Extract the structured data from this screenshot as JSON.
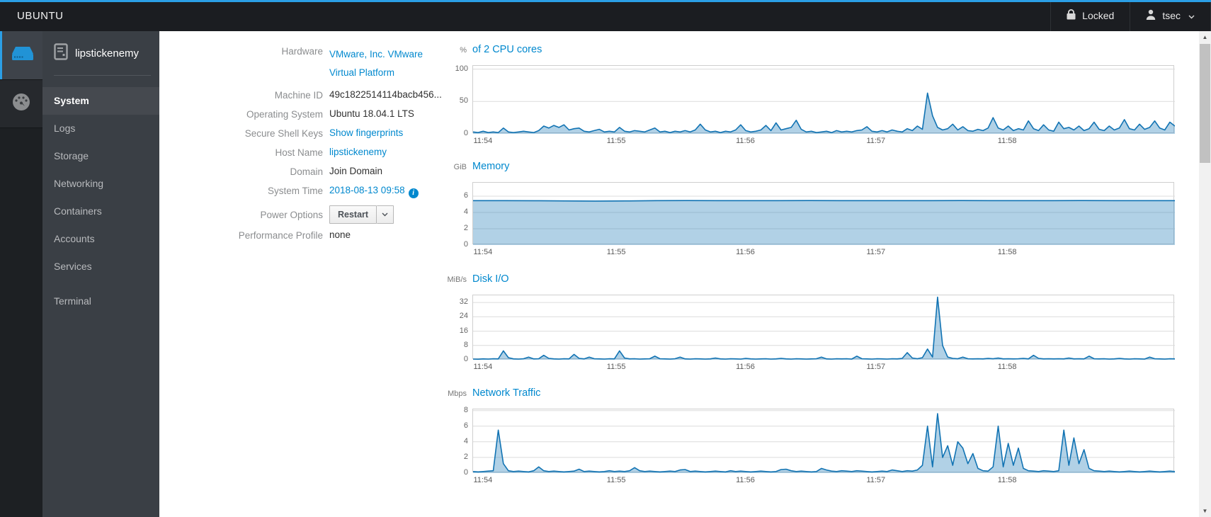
{
  "topbar": {
    "brand": "UBUNTU",
    "locked_label": "Locked",
    "user": "tsec"
  },
  "sidebar": {
    "host": "lipstickenemy",
    "items": [
      {
        "label": "System"
      },
      {
        "label": "Logs"
      },
      {
        "label": "Storage"
      },
      {
        "label": "Networking"
      },
      {
        "label": "Containers"
      },
      {
        "label": "Accounts"
      },
      {
        "label": "Services"
      }
    ],
    "secondary_items": [
      {
        "label": "Terminal"
      }
    ]
  },
  "info": {
    "rows": [
      {
        "label": "Hardware",
        "value_lines": [
          "VMware, Inc. VMware",
          "Virtual Platform"
        ]
      },
      {
        "label": "Machine ID",
        "value": "49c1822514114bacb456..."
      },
      {
        "label": "Operating System",
        "value": "Ubuntu 18.04.1 LTS"
      },
      {
        "label": "Secure Shell Keys",
        "value": "Show fingerprints"
      },
      {
        "label": "Host Name",
        "value": "lipstickenemy"
      },
      {
        "label": "Domain",
        "value": "Join Domain"
      },
      {
        "label": "System Time",
        "value": "2018-08-13 09:58"
      },
      {
        "label": "Power Options",
        "value": "Restart"
      },
      {
        "label": "Performance Profile",
        "value": "none"
      }
    ],
    "info_icon_glyph": "i"
  },
  "scrollbar": {
    "up_glyph": "▲",
    "down_glyph": "▼"
  },
  "colors": {
    "accent": "#0088ce",
    "topbar_blue": "#2b9fe6",
    "chart_line": "#1173b3",
    "chart_fill": "rgba(49,133,188,0.38)"
  },
  "chart_data": [
    {
      "type": "area",
      "unit": "%",
      "title": "of 2 CPU cores",
      "ylabel": "percent of 2 CPU cores",
      "ylim": [
        0,
        105
      ],
      "yticks": [
        0,
        50,
        100
      ],
      "grid": true,
      "x_ticks": [
        {
          "label": "11:54",
          "frac": 0.015
        },
        {
          "label": "11:55",
          "frac": 0.205
        },
        {
          "label": "11:56",
          "frac": 0.389
        },
        {
          "label": "11:57",
          "frac": 0.575
        },
        {
          "label": "11:58",
          "frac": 0.762
        }
      ],
      "values": [
        3,
        2,
        4,
        2,
        3,
        2,
        9,
        3,
        2,
        3,
        4,
        3,
        2,
        5,
        12,
        9,
        13,
        10,
        14,
        6,
        8,
        9,
        4,
        3,
        5,
        7,
        3,
        4,
        3,
        10,
        4,
        3,
        5,
        4,
        3,
        6,
        9,
        3,
        4,
        2,
        4,
        3,
        5,
        3,
        6,
        15,
        6,
        3,
        4,
        2,
        4,
        3,
        6,
        14,
        5,
        3,
        4,
        6,
        13,
        5,
        17,
        6,
        8,
        10,
        21,
        7,
        3,
        4,
        2,
        3,
        4,
        2,
        5,
        3,
        4,
        3,
        5,
        6,
        11,
        4,
        3,
        5,
        3,
        6,
        4,
        3,
        8,
        5,
        12,
        7,
        63,
        28,
        10,
        6,
        8,
        15,
        6,
        11,
        5,
        4,
        7,
        5,
        9,
        25,
        9,
        6,
        12,
        5,
        8,
        6,
        20,
        8,
        5,
        14,
        6,
        4,
        18,
        8,
        10,
        6,
        12,
        5,
        8,
        18,
        7,
        5,
        12,
        6,
        9,
        22,
        8,
        6,
        15,
        7,
        10,
        20,
        9,
        6,
        18,
        12
      ]
    },
    {
      "type": "area",
      "unit": "GiB",
      "title": "Memory",
      "ylabel": "memory used GiB",
      "ylim": [
        0,
        7.65
      ],
      "yticks": [
        0,
        2,
        4,
        6
      ],
      "grid": true,
      "x_ticks": [
        {
          "label": "11:54",
          "frac": 0.015
        },
        {
          "label": "11:55",
          "frac": 0.205
        },
        {
          "label": "11:56",
          "frac": 0.389
        },
        {
          "label": "11:57",
          "frac": 0.575
        },
        {
          "label": "11:58",
          "frac": 0.762
        }
      ],
      "values": [
        5.45,
        5.45,
        5.44,
        5.42,
        5.4,
        5.42,
        5.45,
        5.46,
        5.45,
        5.45,
        5.45,
        5.46,
        5.45,
        5.45,
        5.45,
        5.45,
        5.46,
        5.45,
        5.45,
        5.45,
        5.46,
        5.45,
        5.45,
        5.45
      ]
    },
    {
      "type": "area",
      "unit": "MiB/s",
      "title": "Disk I/O",
      "ylabel": "disk io MiB per second",
      "ylim": [
        0,
        36
      ],
      "yticks": [
        0,
        8,
        16,
        24,
        32
      ],
      "grid": true,
      "x_ticks": [
        {
          "label": "11:54",
          "frac": 0.015
        },
        {
          "label": "11:55",
          "frac": 0.205
        },
        {
          "label": "11:56",
          "frac": 0.389
        },
        {
          "label": "11:57",
          "frac": 0.575
        },
        {
          "label": "11:58",
          "frac": 0.762
        }
      ],
      "values": [
        0.4,
        0.3,
        0.5,
        0.4,
        0.6,
        0.5,
        5,
        1.2,
        0.5,
        0.4,
        0.6,
        1.5,
        0.5,
        0.6,
        2.5,
        0.8,
        0.5,
        0.4,
        0.6,
        0.5,
        3,
        0.8,
        0.5,
        1.5,
        0.6,
        0.5,
        0.4,
        0.6,
        0.5,
        5,
        1,
        0.5,
        0.6,
        0.4,
        0.5,
        0.6,
        2,
        0.6,
        0.5,
        0.4,
        0.6,
        1.5,
        0.5,
        0.4,
        0.6,
        0.5,
        0.4,
        0.5,
        1,
        0.5,
        0.4,
        0.6,
        0.5,
        0.4,
        0.8,
        0.5,
        0.4,
        0.5,
        0.6,
        0.4,
        0.5,
        0.8,
        0.5,
        0.4,
        0.6,
        0.5,
        0.4,
        0.5,
        0.6,
        1.5,
        0.5,
        0.4,
        0.6,
        0.5,
        0.6,
        0.4,
        2,
        0.6,
        0.5,
        0.4,
        0.6,
        0.5,
        0.4,
        0.6,
        0.5,
        0.8,
        4,
        1,
        0.6,
        1.2,
        6,
        1.5,
        35,
        8,
        1.5,
        0.8,
        0.6,
        1.5,
        0.6,
        0.5,
        0.6,
        0.5,
        0.8,
        0.6,
        1,
        0.5,
        0.6,
        0.5,
        0.6,
        0.8,
        0.5,
        2.5,
        0.8,
        0.5,
        0.6,
        0.5,
        0.6,
        0.5,
        1,
        0.5,
        0.6,
        0.5,
        2,
        0.6,
        0.5,
        0.6,
        0.4,
        0.5,
        0.8,
        0.5,
        0.4,
        0.6,
        0.5,
        0.4,
        1.5,
        0.6,
        0.5,
        0.4,
        0.6,
        0.5
      ]
    },
    {
      "type": "area",
      "unit": "Mbps",
      "title": "Network Traffic",
      "ylabel": "network traffic Mbps",
      "ylim": [
        0,
        8.15
      ],
      "yticks": [
        0,
        2,
        4,
        6,
        8
      ],
      "grid": true,
      "x_ticks": [
        {
          "label": "11:54",
          "frac": 0.015
        },
        {
          "label": "11:55",
          "frac": 0.205
        },
        {
          "label": "11:56",
          "frac": 0.389
        },
        {
          "label": "11:57",
          "frac": 0.575
        },
        {
          "label": "11:58",
          "frac": 0.762
        }
      ],
      "values": [
        0.2,
        0.15,
        0.2,
        0.25,
        0.3,
        5.5,
        1.2,
        0.3,
        0.2,
        0.25,
        0.2,
        0.15,
        0.3,
        0.8,
        0.3,
        0.2,
        0.25,
        0.2,
        0.15,
        0.2,
        0.25,
        0.5,
        0.2,
        0.25,
        0.2,
        0.15,
        0.2,
        0.3,
        0.2,
        0.25,
        0.2,
        0.3,
        0.7,
        0.3,
        0.2,
        0.25,
        0.2,
        0.15,
        0.2,
        0.25,
        0.2,
        0.4,
        0.45,
        0.2,
        0.25,
        0.2,
        0.15,
        0.2,
        0.25,
        0.2,
        0.15,
        0.3,
        0.2,
        0.25,
        0.2,
        0.15,
        0.2,
        0.25,
        0.2,
        0.15,
        0.2,
        0.45,
        0.5,
        0.3,
        0.2,
        0.25,
        0.2,
        0.15,
        0.2,
        0.6,
        0.4,
        0.25,
        0.2,
        0.3,
        0.25,
        0.2,
        0.3,
        0.25,
        0.2,
        0.15,
        0.2,
        0.25,
        0.2,
        0.4,
        0.3,
        0.2,
        0.3,
        0.25,
        0.4,
        1,
        6,
        0.8,
        7.6,
        2,
        3.5,
        1,
        4,
        3.2,
        1.2,
        2.5,
        0.6,
        0.3,
        0.25,
        0.8,
        6,
        0.8,
        3.8,
        1,
        3.2,
        0.6,
        0.3,
        0.25,
        0.2,
        0.3,
        0.25,
        0.2,
        0.3,
        5.5,
        1,
        4.5,
        1.2,
        3,
        0.6,
        0.3,
        0.25,
        0.2,
        0.25,
        0.2,
        0.15,
        0.2,
        0.25,
        0.2,
        0.15,
        0.2,
        0.25,
        0.2,
        0.15,
        0.2,
        0.25,
        0.2
      ]
    }
  ]
}
